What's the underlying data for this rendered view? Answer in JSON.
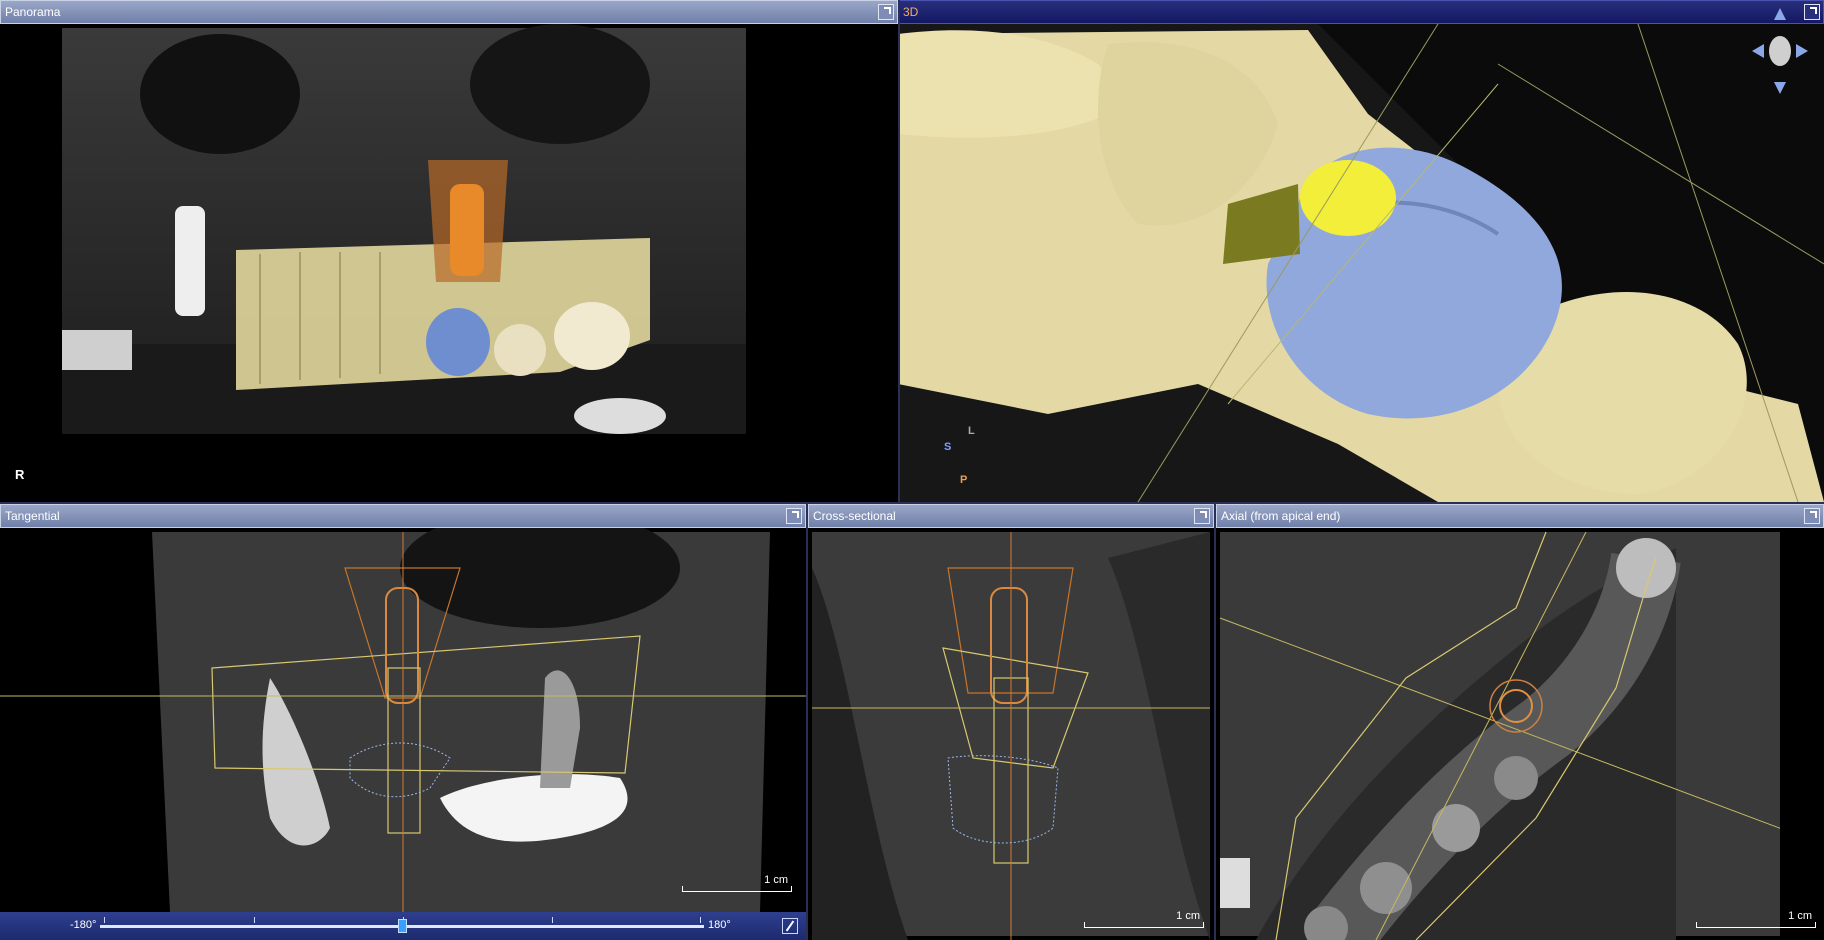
{
  "panels": {
    "panorama": {
      "title": "Panorama",
      "orientation_label": "R"
    },
    "three_d": {
      "title": "3D",
      "axis": {
        "s": "S",
        "l": "L",
        "p": "P"
      }
    },
    "tangential": {
      "title": "Tangential",
      "scale_label": "1 cm"
    },
    "cross_sectional": {
      "title": "Cross-sectional",
      "scale_label": "1 cm"
    },
    "axial": {
      "title": "Axial (from apical end)",
      "scale_label": "1 cm"
    }
  },
  "rotation_slider": {
    "min_label": "-180°",
    "max_label": "180°",
    "value": 0.5
  },
  "colors": {
    "titlebar": "#7f8db6",
    "active_titlebar": "#1a1f6f",
    "implant_orange": "#e07a20",
    "crown_blue": "#8fa8dc",
    "bone_beige": "#e8dfa8",
    "guide_yellow": "#d8d060"
  }
}
